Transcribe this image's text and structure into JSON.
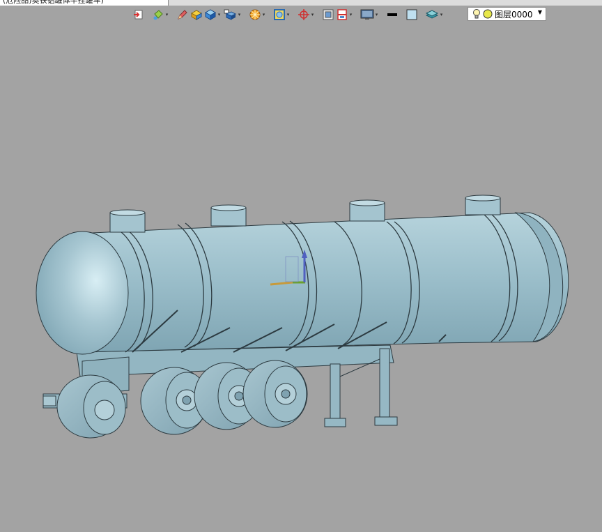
{
  "document": {
    "tab_title": "(危险品)奥铁铝罐体半挂罐车)"
  },
  "toolbar": {
    "buttons": [
      {
        "name": "exit-sketch-icon"
      },
      {
        "name": "paint-bucket-icon",
        "dropdown": true
      },
      {
        "name": "pencil-icon"
      },
      {
        "name": "box-shaded-icon"
      },
      {
        "name": "cube-view-icon",
        "dropdown": true
      },
      {
        "name": "view-orientation-icon",
        "dropdown": true
      },
      {
        "name": "render-sphere-icon",
        "dropdown": true
      },
      {
        "name": "hidden-lines-icon",
        "dropdown": true
      },
      {
        "name": "origin-target-icon",
        "dropdown": true
      },
      {
        "name": "section-view-icon"
      },
      {
        "name": "section-plane-icon",
        "dropdown": true
      },
      {
        "name": "display-monitor-icon",
        "dropdown": true
      },
      {
        "name": "line-color-icon"
      },
      {
        "name": "fill-color-icon"
      },
      {
        "name": "layers-icon",
        "dropdown": true
      }
    ]
  },
  "layer": {
    "name": "图层0000",
    "visible_icon": "light-bulb-icon",
    "status_icon": "yellow-dot-icon",
    "colors": {
      "bulb": "#f2d23a",
      "dot": "#e8e84a"
    }
  },
  "viewport": {
    "background": "#a3a3a3",
    "model_color": "#9cbfcb",
    "model_dark": "#6f95a3",
    "triad": {
      "x_color": "#c89a3a",
      "y_color": "#6aa02a",
      "z_color": "#5060c0"
    }
  }
}
